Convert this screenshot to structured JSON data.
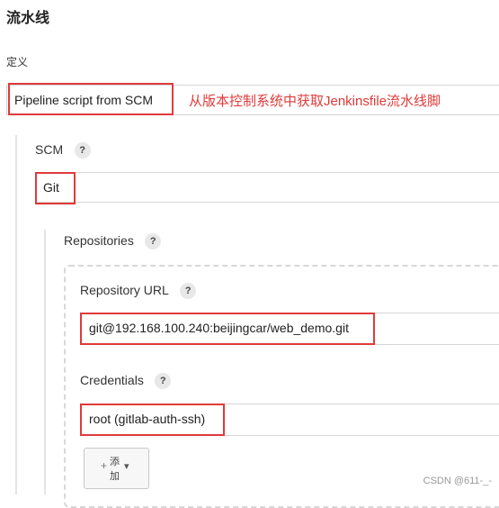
{
  "section": {
    "title": "流水线"
  },
  "definition": {
    "label": "定义",
    "value": "Pipeline script from SCM",
    "annotation": "从版本控制系统中获取Jenkinsfile流水线脚"
  },
  "scm": {
    "label": "SCM",
    "help": "?",
    "value": "Git"
  },
  "repositories": {
    "label": "Repositories",
    "help": "?",
    "url_label": "Repository URL",
    "url_help": "?",
    "url_value": "git@192.168.100.240:beijingcar/web_demo.git",
    "credentials_label": "Credentials",
    "credentials_help": "?",
    "credentials_value": "root (gitlab-auth-ssh)",
    "add_button": {
      "plus": "+",
      "line1": "添",
      "line2": "加",
      "caret": "▾"
    }
  },
  "watermark": "CSDN @611-_-",
  "colors": {
    "annotation_red": "#e03a3a",
    "border": "#d5d5d5"
  }
}
